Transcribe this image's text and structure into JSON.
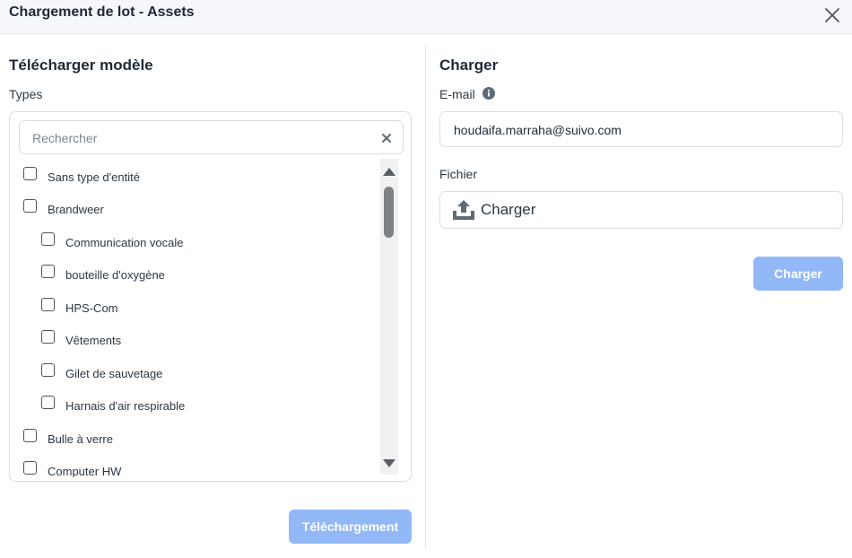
{
  "dialog": {
    "title": "Chargement de lot - Assets"
  },
  "left": {
    "title": "Télécharger modèle",
    "types_label": "Types",
    "search": {
      "placeholder": "Rechercher",
      "value": ""
    },
    "items": [
      {
        "label": "Sans type d'entité",
        "level": 0,
        "checked": false
      },
      {
        "label": "Brandweer",
        "level": 0,
        "checked": false
      },
      {
        "label": "Communication vocale",
        "level": 1,
        "checked": false
      },
      {
        "label": "bouteille d'oxygène",
        "level": 1,
        "checked": false
      },
      {
        "label": "HPS-Com",
        "level": 1,
        "checked": false
      },
      {
        "label": "Vêtements",
        "level": 1,
        "checked": false
      },
      {
        "label": "Gilet de sauvetage",
        "level": 1,
        "checked": false
      },
      {
        "label": "Harnais d'air respirable",
        "level": 1,
        "checked": false
      },
      {
        "label": "Bulle à verre",
        "level": 0,
        "checked": false
      },
      {
        "label": "Computer HW",
        "level": 0,
        "checked": false
      }
    ],
    "download_button": "Téléchargement"
  },
  "right": {
    "title": "Charger",
    "email_label": "E-mail",
    "email_value": "houdaifa.marraha@suivo.com",
    "file_label": "Fichier",
    "upload_label": "Charger",
    "submit_button": "Charger"
  },
  "colors": {
    "button_disabled": "#93b8f8",
    "border": "#d8dde3",
    "header_bg": "#f5f7fa",
    "icon_gray": "#5b6b7a"
  },
  "icons": {
    "close": "close-icon",
    "search_clear": "clear-icon",
    "info": "info-icon",
    "upload": "upload-icon"
  }
}
